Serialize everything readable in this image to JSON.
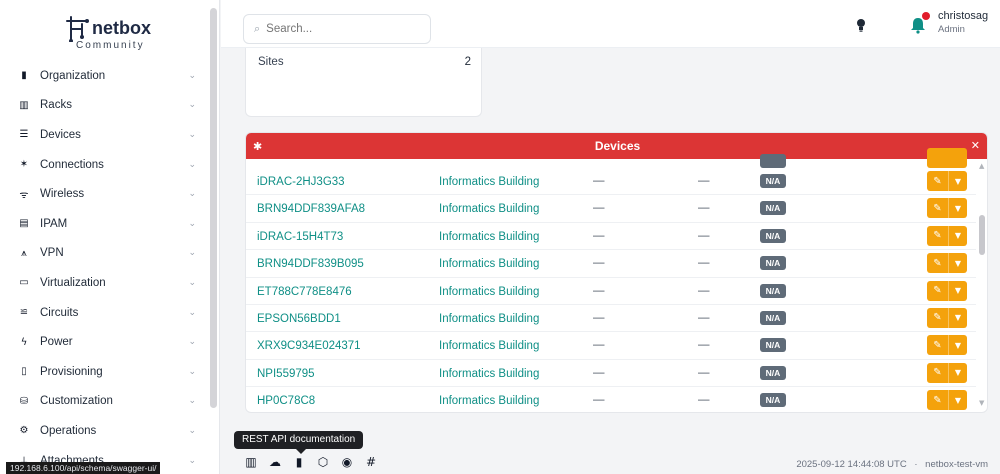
{
  "brand": {
    "name": "netbox",
    "edition": "Community"
  },
  "sidebar": {
    "items": [
      {
        "label": "Organization",
        "icon": "building-icon",
        "glyph": "▮"
      },
      {
        "label": "Racks",
        "icon": "rack-icon",
        "glyph": "▥"
      },
      {
        "label": "Devices",
        "icon": "server-icon",
        "glyph": "☰"
      },
      {
        "label": "Connections",
        "icon": "plug-icon",
        "glyph": "✶"
      },
      {
        "label": "Wireless",
        "icon": "wifi-icon",
        "glyph": "ᯤ"
      },
      {
        "label": "IPAM",
        "icon": "counter-icon",
        "glyph": "▤"
      },
      {
        "label": "VPN",
        "icon": "tunnel-icon",
        "glyph": "⩚"
      },
      {
        "label": "Virtualization",
        "icon": "monitor-icon",
        "glyph": "▭"
      },
      {
        "label": "Circuits",
        "icon": "transit-icon",
        "glyph": "≌"
      },
      {
        "label": "Power",
        "icon": "flash-icon",
        "glyph": "ϟ"
      },
      {
        "label": "Provisioning",
        "icon": "file-icon",
        "glyph": "▯"
      },
      {
        "label": "Customization",
        "icon": "palette-icon",
        "glyph": "⛁"
      },
      {
        "label": "Operations",
        "icon": "cogs-icon",
        "glyph": "⚙"
      },
      {
        "label": "Attachments",
        "icon": "paperclip-icon",
        "glyph": "⏚"
      }
    ],
    "chevron": "⌄"
  },
  "status_url": "192.168.6.100/api/schema/swagger-ui/",
  "header": {
    "search_placeholder": "Search...",
    "user": {
      "name": "christosag",
      "role": "Admin"
    }
  },
  "sites_card": {
    "label": "Sites",
    "count": "2"
  },
  "devices_panel": {
    "title": "Devices",
    "rows": [
      {
        "name": "iDRAC-2HJ3G33",
        "site": "Informatics Building",
        "col3": "—",
        "col4": "—",
        "status": "N/A"
      },
      {
        "name": "BRN94DDF839AFA8",
        "site": "Informatics Building",
        "col3": "—",
        "col4": "—",
        "status": "N/A"
      },
      {
        "name": "iDRAC-15H4T73",
        "site": "Informatics Building",
        "col3": "—",
        "col4": "—",
        "status": "N/A"
      },
      {
        "name": "BRN94DDF839B095",
        "site": "Informatics Building",
        "col3": "—",
        "col4": "—",
        "status": "N/A"
      },
      {
        "name": "ET788C778E8476",
        "site": "Informatics Building",
        "col3": "—",
        "col4": "—",
        "status": "N/A"
      },
      {
        "name": "EPSON56BDD1",
        "site": "Informatics Building",
        "col3": "—",
        "col4": "—",
        "status": "N/A"
      },
      {
        "name": "XRX9C934E024371",
        "site": "Informatics Building",
        "col3": "—",
        "col4": "—",
        "status": "N/A"
      },
      {
        "name": "NPI559795",
        "site": "Informatics Building",
        "col3": "—",
        "col4": "—",
        "status": "N/A"
      },
      {
        "name": "HP0C78C8",
        "site": "Informatics Building",
        "col3": "—",
        "col4": "—",
        "status": "N/A"
      }
    ]
  },
  "footer": {
    "tooltip": "REST API documentation",
    "icons": [
      "book-icon",
      "cloud-icon",
      "api-doc-icon",
      "graphql-icon",
      "github-icon",
      "slack-icon"
    ],
    "timestamp": "2025-09-12 14:44:08 UTC",
    "separator": "·",
    "hostname": "netbox-test-vm"
  },
  "colors": {
    "accent": "#0f8f86",
    "panel_header": "#dc3535",
    "edit_button": "#f4a20c",
    "badge": "#5f6b78"
  }
}
